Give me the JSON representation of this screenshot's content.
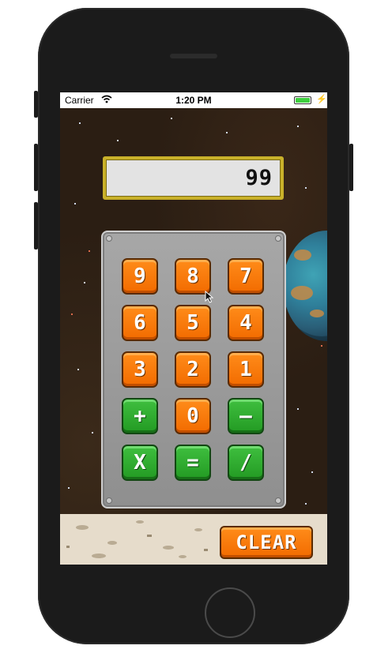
{
  "status_bar": {
    "carrier": "Carrier",
    "wifi_icon": "wifi-icon",
    "time": "1:20 PM",
    "battery_icon": "battery-icon",
    "charging_icon": "charging-bolt-icon"
  },
  "display": {
    "value": "99"
  },
  "keypad": {
    "rows": [
      [
        {
          "label": "9",
          "color": "orange"
        },
        {
          "label": "8",
          "color": "orange"
        },
        {
          "label": "7",
          "color": "orange"
        }
      ],
      [
        {
          "label": "6",
          "color": "orange"
        },
        {
          "label": "5",
          "color": "orange"
        },
        {
          "label": "4",
          "color": "orange"
        }
      ],
      [
        {
          "label": "3",
          "color": "orange"
        },
        {
          "label": "2",
          "color": "orange"
        },
        {
          "label": "1",
          "color": "orange"
        }
      ],
      [
        {
          "label": "+",
          "color": "green"
        },
        {
          "label": "0",
          "color": "orange"
        },
        {
          "label": "—",
          "color": "green"
        }
      ],
      [
        {
          "label": "X",
          "color": "green"
        },
        {
          "label": "=",
          "color": "green"
        },
        {
          "label": "/",
          "color": "green"
        }
      ]
    ]
  },
  "clear_button": {
    "label": "CLEAR"
  },
  "colors": {
    "key_orange": "#f57a0a",
    "key_green": "#2ea82e",
    "display_border": "#c9b12a",
    "panel": "#9b9b9b",
    "background_space": "#2b1e13",
    "ground": "#e6dccb"
  }
}
